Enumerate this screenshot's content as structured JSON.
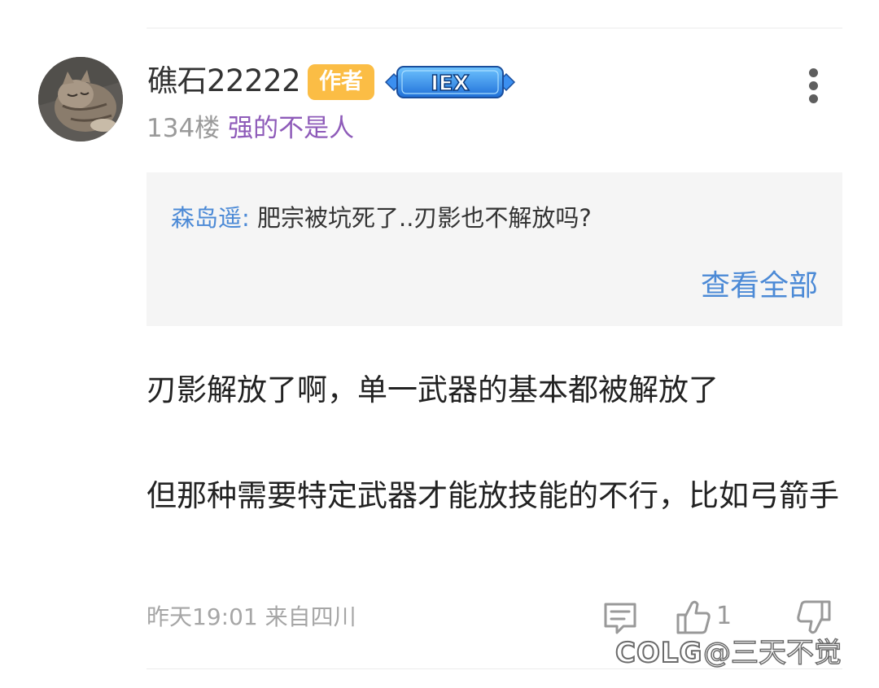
{
  "post": {
    "username": "礁石22222",
    "author_badge": "作者",
    "level_badge": "IEX",
    "floor": "134楼",
    "user_title": "强的不是人"
  },
  "quote": {
    "author": "森岛遥:",
    "text": "肥宗被坑死了..刃影也不解放吗?",
    "view_all": "查看全部"
  },
  "body": {
    "paragraph1": "刃影解放了啊，单一武器的基本都被解放了",
    "paragraph2": "但那种需要特定武器才能放技能的不行，比如弓箭手"
  },
  "footer": {
    "meta": "昨天19:01 来自四川",
    "like_count": "1"
  },
  "watermark": {
    "logo": "COLG",
    "text": "@三天不觉"
  },
  "colors": {
    "author_badge": "#fbbd45",
    "link_blue": "#4c8ad6",
    "title_purple": "#8e5bb9",
    "quote_bg": "#f5f5f5"
  }
}
